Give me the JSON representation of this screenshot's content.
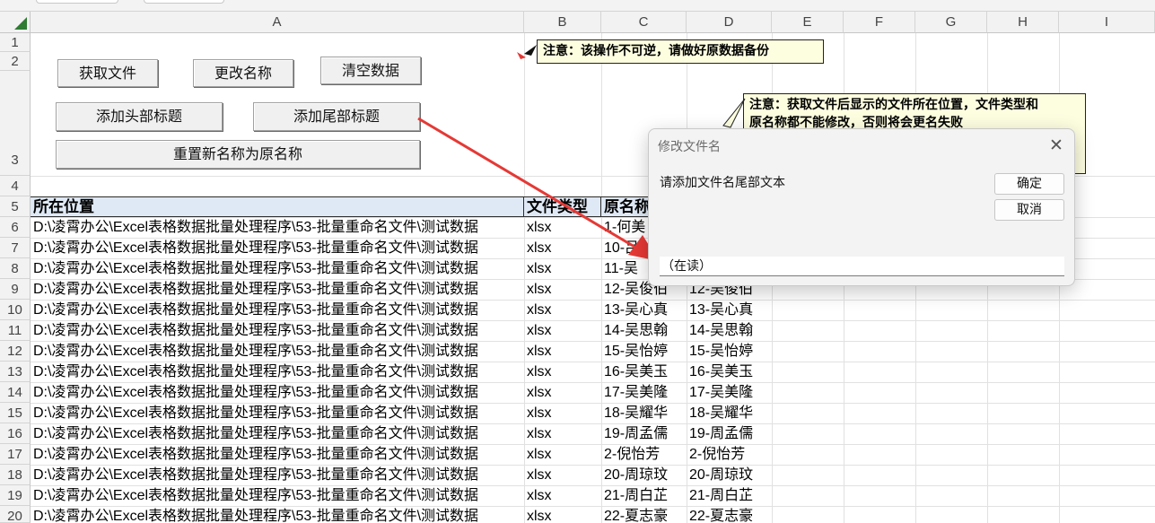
{
  "columns": [
    "A",
    "B",
    "C",
    "D",
    "E",
    "F",
    "G",
    "H",
    "I"
  ],
  "rows": [
    "1",
    "2",
    "3",
    "4",
    "5",
    "6",
    "7",
    "8",
    "9",
    "10",
    "11",
    "12",
    "13",
    "14",
    "15",
    "16",
    "17",
    "18",
    "19",
    "20"
  ],
  "buttons": {
    "get_file": "获取文件",
    "rename": "更改名称",
    "clear_data": "清空数据",
    "add_head_title": "添加头部标题",
    "add_tail_title": "添加尾部标题",
    "reset_name": "重置新名称为原名称"
  },
  "notes": {
    "note1": "注意：该操作不可逆，请做好原数据备份",
    "note2_line1": "注意：获取文件后显示的文件所在位置，文件类型和",
    "note2_line2": "原名称都不能修改，否则将会更名失败"
  },
  "table": {
    "headers": {
      "location": "所在位置",
      "file_type": "文件类型",
      "orig_name": "原名称"
    },
    "rows": [
      {
        "location": "D:\\凌霄办公\\Excel表格数据批量处理程序\\53-批量重命名文件\\测试数据",
        "type": "xlsx",
        "orig": "1-何美",
        "new": ""
      },
      {
        "location": "D:\\凌霄办公\\Excel表格数据批量处理程序\\53-批量重命名文件\\测试数据",
        "type": "xlsx",
        "orig": "10-吕",
        "new": ""
      },
      {
        "location": "D:\\凌霄办公\\Excel表格数据批量处理程序\\53-批量重命名文件\\测试数据",
        "type": "xlsx",
        "orig": "11-吴",
        "new": ""
      },
      {
        "location": "D:\\凌霄办公\\Excel表格数据批量处理程序\\53-批量重命名文件\\测试数据",
        "type": "xlsx",
        "orig": "12-吴俊伯",
        "new": "12-吴俊伯"
      },
      {
        "location": "D:\\凌霄办公\\Excel表格数据批量处理程序\\53-批量重命名文件\\测试数据",
        "type": "xlsx",
        "orig": "13-吴心真",
        "new": "13-吴心真"
      },
      {
        "location": "D:\\凌霄办公\\Excel表格数据批量处理程序\\53-批量重命名文件\\测试数据",
        "type": "xlsx",
        "orig": "14-吴思翰",
        "new": "14-吴思翰"
      },
      {
        "location": "D:\\凌霄办公\\Excel表格数据批量处理程序\\53-批量重命名文件\\测试数据",
        "type": "xlsx",
        "orig": "15-吴怡婷",
        "new": "15-吴怡婷"
      },
      {
        "location": "D:\\凌霄办公\\Excel表格数据批量处理程序\\53-批量重命名文件\\测试数据",
        "type": "xlsx",
        "orig": "16-吴美玉",
        "new": "16-吴美玉"
      },
      {
        "location": "D:\\凌霄办公\\Excel表格数据批量处理程序\\53-批量重命名文件\\测试数据",
        "type": "xlsx",
        "orig": "17-吴美隆",
        "new": "17-吴美隆"
      },
      {
        "location": "D:\\凌霄办公\\Excel表格数据批量处理程序\\53-批量重命名文件\\测试数据",
        "type": "xlsx",
        "orig": "18-吴耀华",
        "new": "18-吴耀华"
      },
      {
        "location": "D:\\凌霄办公\\Excel表格数据批量处理程序\\53-批量重命名文件\\测试数据",
        "type": "xlsx",
        "orig": "19-周孟儒",
        "new": "19-周孟儒"
      },
      {
        "location": "D:\\凌霄办公\\Excel表格数据批量处理程序\\53-批量重命名文件\\测试数据",
        "type": "xlsx",
        "orig": "2-倪怡芳",
        "new": "2-倪怡芳"
      },
      {
        "location": "D:\\凌霄办公\\Excel表格数据批量处理程序\\53-批量重命名文件\\测试数据",
        "type": "xlsx",
        "orig": "20-周琼玟",
        "new": "20-周琼玟"
      },
      {
        "location": "D:\\凌霄办公\\Excel表格数据批量处理程序\\53-批量重命名文件\\测试数据",
        "type": "xlsx",
        "orig": "21-周白芷",
        "new": "21-周白芷"
      },
      {
        "location": "D:\\凌霄办公\\Excel表格数据批量处理程序\\53-批量重命名文件\\测试数据",
        "type": "xlsx",
        "orig": "22-夏志豪",
        "new": "22-夏志豪"
      }
    ]
  },
  "dialog": {
    "title": "修改文件名",
    "prompt": "请添加文件名尾部文本",
    "ok": "确定",
    "cancel": "取消",
    "input_value": "（在读）",
    "close_glyph": "✕"
  },
  "colors": {
    "header_fill": "#dfe9f5",
    "note_fill": "#fdfde0",
    "arrow": "#e53935",
    "select_corner": "#2e7d32"
  }
}
